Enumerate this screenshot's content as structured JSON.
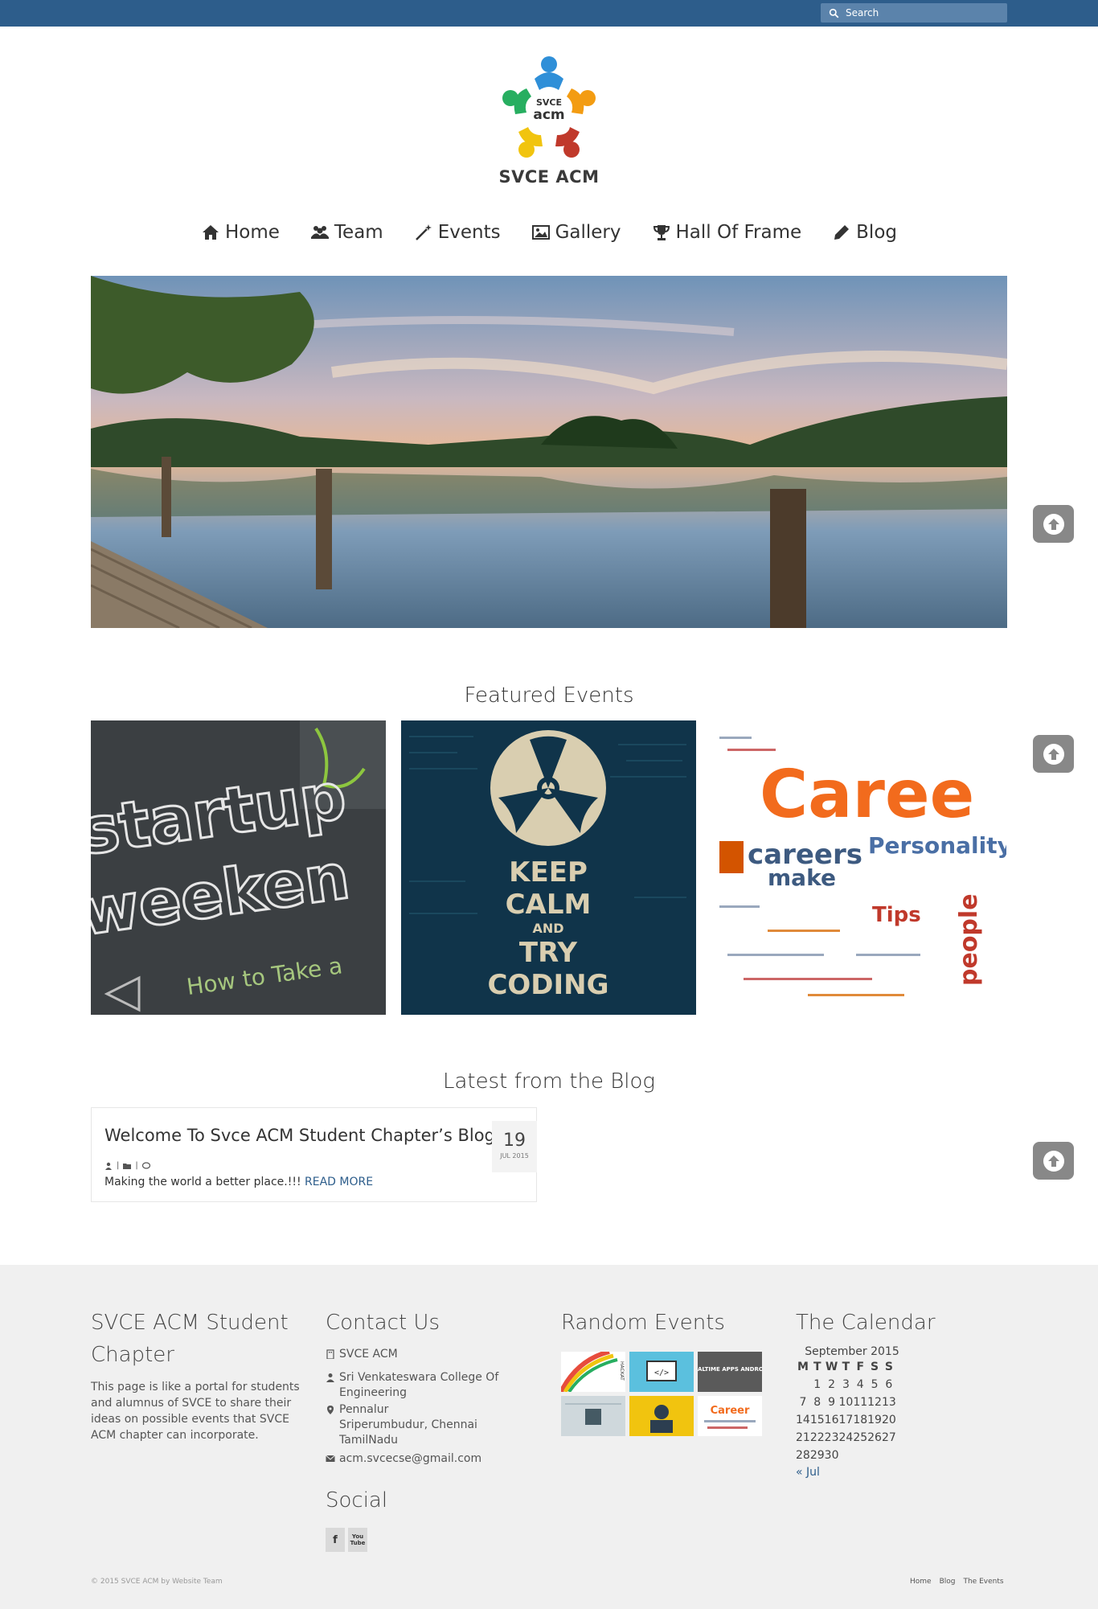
{
  "topbar": {
    "search_placeholder": "Search"
  },
  "logo": {
    "badge_line1": "SVCE",
    "badge_line2": "acm",
    "name": "SVCE ACM"
  },
  "nav": {
    "items": [
      {
        "label": "Home",
        "icon": "home-icon"
      },
      {
        "label": "Team",
        "icon": "users-icon"
      },
      {
        "label": "Events",
        "icon": "magic-wand-icon"
      },
      {
        "label": "Gallery",
        "icon": "image-icon"
      },
      {
        "label": "Hall Of Frame",
        "icon": "trophy-icon"
      },
      {
        "label": "Blog",
        "icon": "pencil-icon"
      }
    ]
  },
  "featured": {
    "title": "Featured Events",
    "items": [
      {
        "image": "startup-weekend",
        "lines": [
          "startup",
          "weeken",
          "How to Take a"
        ]
      },
      {
        "image": "keep-calm-coding",
        "lines": [
          "KEEP",
          "CALM",
          "AND",
          "TRY",
          "CODING"
        ]
      },
      {
        "image": "career-word-cloud",
        "lines": [
          "Caree",
          "careers",
          "Personality",
          "make",
          "people",
          "Tips"
        ]
      }
    ]
  },
  "blog": {
    "title": "Latest from the Blog",
    "post": {
      "title": "Welcome To Svce ACM Student Chapter’s Blog",
      "day": "19",
      "month": "JUL 2015",
      "excerpt": "Making the world a better place.!!!",
      "read_more": "READ MORE"
    }
  },
  "footer": {
    "about": {
      "title": "SVCE ACM Student Chapter",
      "text": "This page is like a portal for students and alumnus of SVCE to share their ideas on possible events that SVCE ACM chapter can incorporate."
    },
    "contact": {
      "title": "Contact Us",
      "name": "SVCE ACM",
      "college": "Sri Venkateswara College Of Engineering",
      "address_line1": "Pennalur",
      "address_line2": "Sriperumbudur, Chennai TamilNadu",
      "email": "acm.svcecse@gmail.com"
    },
    "social": {
      "title": "Social",
      "facebook": "f",
      "youtube": "You Tube"
    },
    "random_events": {
      "title": "Random Events",
      "thumb_labels": [
        "HACKAT",
        "</>",
        "REALTIME APPS ANDROID",
        "",
        "",
        "Career"
      ]
    },
    "calendar": {
      "title": "The Calendar",
      "caption": "September 2015",
      "weekdays": [
        "M",
        "T",
        "W",
        "T",
        "F",
        "S",
        "S"
      ],
      "weeks": [
        [
          "",
          "1",
          "2",
          "3",
          "4",
          "5",
          "6"
        ],
        [
          "7",
          "8",
          "9",
          "10",
          "11",
          "12",
          "13"
        ],
        [
          "14",
          "15",
          "16",
          "17",
          "18",
          "19",
          "20"
        ],
        [
          "21",
          "22",
          "23",
          "24",
          "25",
          "26",
          "27"
        ],
        [
          "28",
          "29",
          "30",
          "",
          "",
          "",
          ""
        ]
      ],
      "prev": "« Jul"
    },
    "copyright": "© 2015 SVCE ACM by Website Team",
    "links": [
      "Home",
      "Blog",
      "The Events"
    ]
  },
  "colors": {
    "topbar": "#2d5d8b",
    "accent": "#2d5d8b",
    "footer_bg": "#f0f0f0"
  }
}
